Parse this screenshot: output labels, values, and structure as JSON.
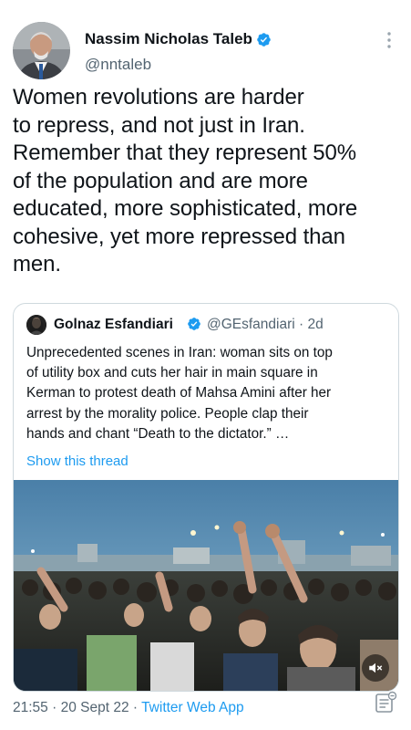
{
  "tweet": {
    "author": {
      "name": "Nassim Nicholas Taleb",
      "handle": "@nntaleb"
    },
    "text_lines": [
      "Women revolutions are harder",
      "to repress, and not just in Iran.",
      "Remember that they represent 50%",
      "of the population and are more",
      "educated, more sophisticated, more",
      "cohesive, yet  more repressed than",
      "men."
    ],
    "quoted": {
      "author_name": "Golnaz Esfandiari",
      "handle_time": "@GEsfandiari · 2d",
      "text_lines": [
        "Unprecedented scenes in Iran: woman sits on top",
        "of utility box and cuts her hair in main square in",
        "Kerman to protest death of Mahsa Amini after her",
        "arrest by the morality police. People clap their",
        "hands and chant “Death to the dictator.” …"
      ],
      "show_thread": "Show this thread"
    },
    "footer": {
      "time": "21:55",
      "separator1": " · ",
      "date": "20 Sept 22",
      "separator2": " · ",
      "source": "Twitter Web App"
    }
  },
  "colors": {
    "link": "#1d9bf0",
    "secondary_text": "#536471",
    "border": "#cfd9de",
    "verified": "#1d9bf0"
  },
  "icons": {
    "verified": "verified-badge-icon",
    "more": "more-vertical-icon",
    "mute": "volume-muted-icon",
    "footer": "analytics-icon"
  }
}
